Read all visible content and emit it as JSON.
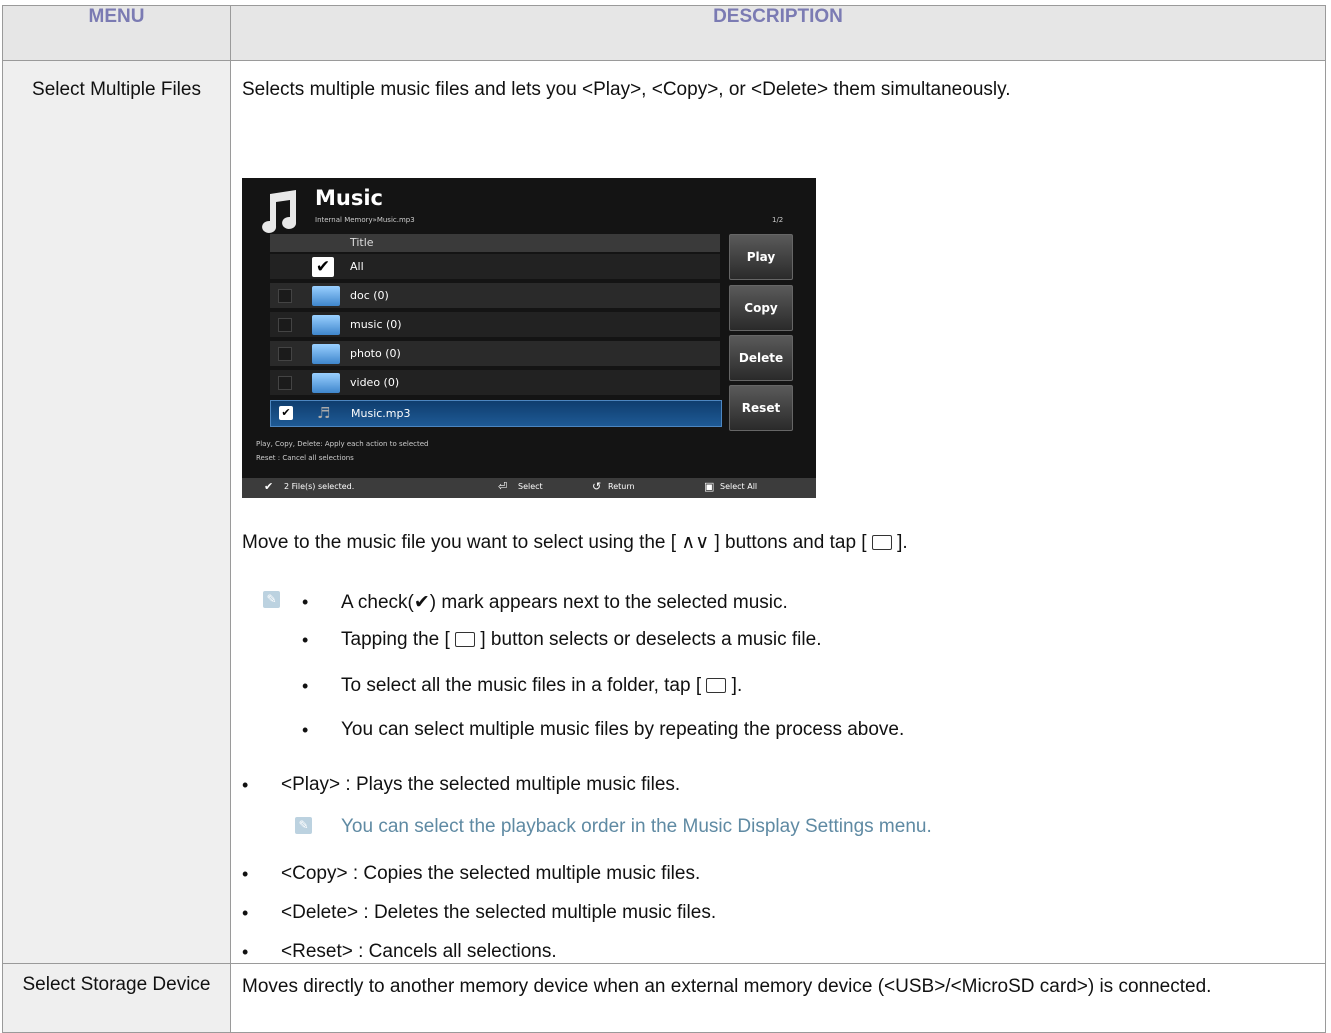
{
  "header": {
    "menu": "MENU",
    "description": "DESCRIPTION"
  },
  "row1": {
    "menu": "Select Multiple Files",
    "intro": "Selects multiple music files and lets you <Play>, <Copy>, or <Delete> them simultaneously.",
    "move_before": "Move to the music file you want to select using the [ ",
    "move_arrows": "∧∨",
    "move_middle": " ] buttons and tap [ ",
    "move_end": " ].",
    "notes": {
      "n1_before": "A check(",
      "n1_check": "✔",
      "n1_after": ") mark appears next to the selected music.",
      "n2_before": "Tapping the [ ",
      "n2_after": " ] button selects or deselects a music file.",
      "n3_before": "To select all the music files in a folder, tap [ ",
      "n3_after": " ].",
      "n4": "You can select multiple music files by repeating the process above."
    },
    "play": "<Play> : Plays the selected multiple music files.",
    "tip": "You can select the playback order in the Music Display Settings menu.",
    "copy": "<Copy> : Copies the selected multiple music files.",
    "delete": "<Delete> : Deletes the selected multiple music files.",
    "reset": "<Reset> : Cancels all selections.",
    "bullet": "•"
  },
  "screenshot": {
    "title": "Music",
    "path": "Internal Memory»Music.mp3",
    "page": "1/2",
    "col_header": "Title",
    "rows": [
      "All",
      "doc (0)",
      "music (0)",
      "photo (0)",
      "video (0)",
      "Music.mp3"
    ],
    "buttons": [
      "Play",
      "Copy",
      "Delete",
      "Reset"
    ],
    "help1": "Play, Copy, Delete: Apply each action to selected",
    "help2": "Reset : Cancel all selections",
    "footer": {
      "selected": "2 File(s) selected.",
      "select": "Select",
      "return": "Return",
      "select_all": "Select All"
    }
  },
  "row2": {
    "menu": "Select Storage Device",
    "text": "Moves directly to another memory device when an external memory device (<USB>/<MicroSD card>) is connected."
  }
}
